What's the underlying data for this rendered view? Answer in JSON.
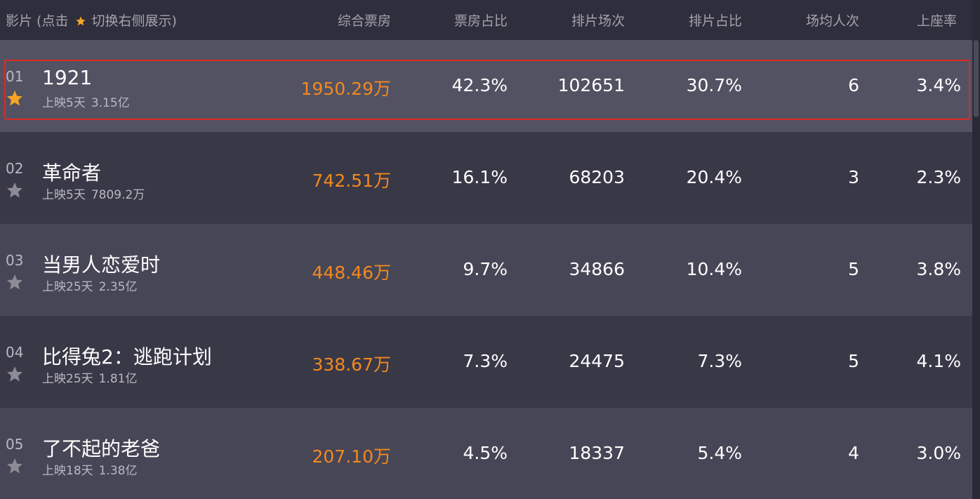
{
  "header": {
    "film_prefix": "影片 (点击",
    "film_suffix": "切换右侧展示)",
    "box_office": "综合票房",
    "box_share": "票房占比",
    "shows": "排片场次",
    "show_share": "排片占比",
    "avg_people": "场均人次",
    "occupancy": "上座率"
  },
  "colors": {
    "accent": "#f2891e",
    "star_active": "#f5a623",
    "star_inactive": "#8c8b96",
    "selection_border": "#e02a20"
  },
  "rows": [
    {
      "rank": "01",
      "title": "1921",
      "days": "上映5天",
      "total": "3.15亿",
      "box": "1950.29万",
      "box_share": "42.3%",
      "shows": "102651",
      "show_share": "30.7%",
      "avg": "6",
      "occupancy": "3.4%",
      "starred": true
    },
    {
      "rank": "02",
      "title": "革命者",
      "days": "上映5天",
      "total": "7809.2万",
      "box": "742.51万",
      "box_share": "16.1%",
      "shows": "68203",
      "show_share": "20.4%",
      "avg": "3",
      "occupancy": "2.3%",
      "starred": false
    },
    {
      "rank": "03",
      "title": "当男人恋爱时",
      "days": "上映25天",
      "total": "2.35亿",
      "box": "448.46万",
      "box_share": "9.7%",
      "shows": "34866",
      "show_share": "10.4%",
      "avg": "5",
      "occupancy": "3.8%",
      "starred": false
    },
    {
      "rank": "04",
      "title": "比得兔2：逃跑计划",
      "days": "上映25天",
      "total": "1.81亿",
      "box": "338.67万",
      "box_share": "7.3%",
      "shows": "24475",
      "show_share": "7.3%",
      "avg": "5",
      "occupancy": "4.1%",
      "starred": false
    },
    {
      "rank": "05",
      "title": "了不起的老爸",
      "days": "上映18天",
      "total": "1.38亿",
      "box": "207.10万",
      "box_share": "4.5%",
      "shows": "18337",
      "show_share": "5.4%",
      "avg": "4",
      "occupancy": "3.0%",
      "starred": false
    }
  ]
}
